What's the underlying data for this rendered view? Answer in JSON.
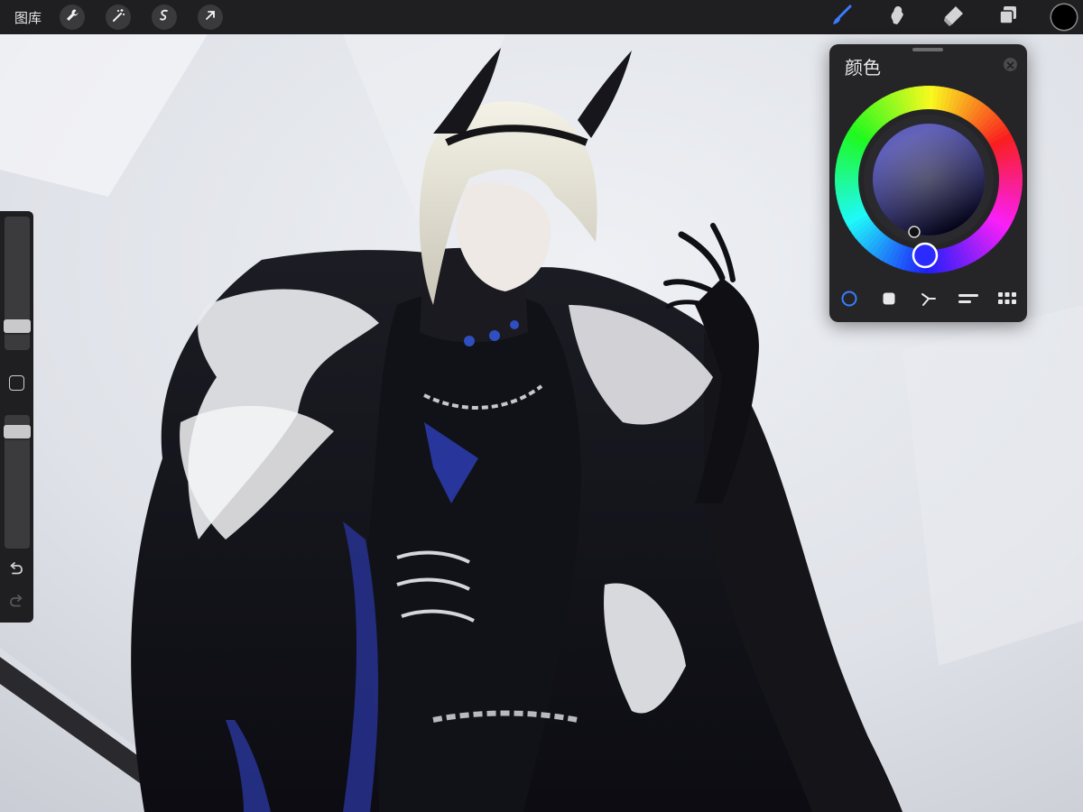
{
  "toolbar": {
    "gallery_label": "图库",
    "left_tools": [
      "wrench-icon",
      "magic-wand-icon",
      "selection-icon",
      "transform-arrow-icon"
    ],
    "right_tools": [
      "brush-icon",
      "smudge-icon",
      "eraser-icon",
      "layers-icon"
    ],
    "active_tool": "brush-icon",
    "current_color": "#000000",
    "accent_color": "#3a7bff"
  },
  "sidebar": {
    "brush_size_level": 0.14,
    "opacity_level": 0.92,
    "icons": [
      "modify-square-icon",
      "undo-icon",
      "redo-icon"
    ]
  },
  "color_panel": {
    "title": "颜色",
    "selected_color": "#2b2bff",
    "active_mode": "disc",
    "modes": [
      "disc-icon",
      "classic-icon",
      "harmony-icon",
      "value-icon",
      "palettes-icon"
    ]
  }
}
